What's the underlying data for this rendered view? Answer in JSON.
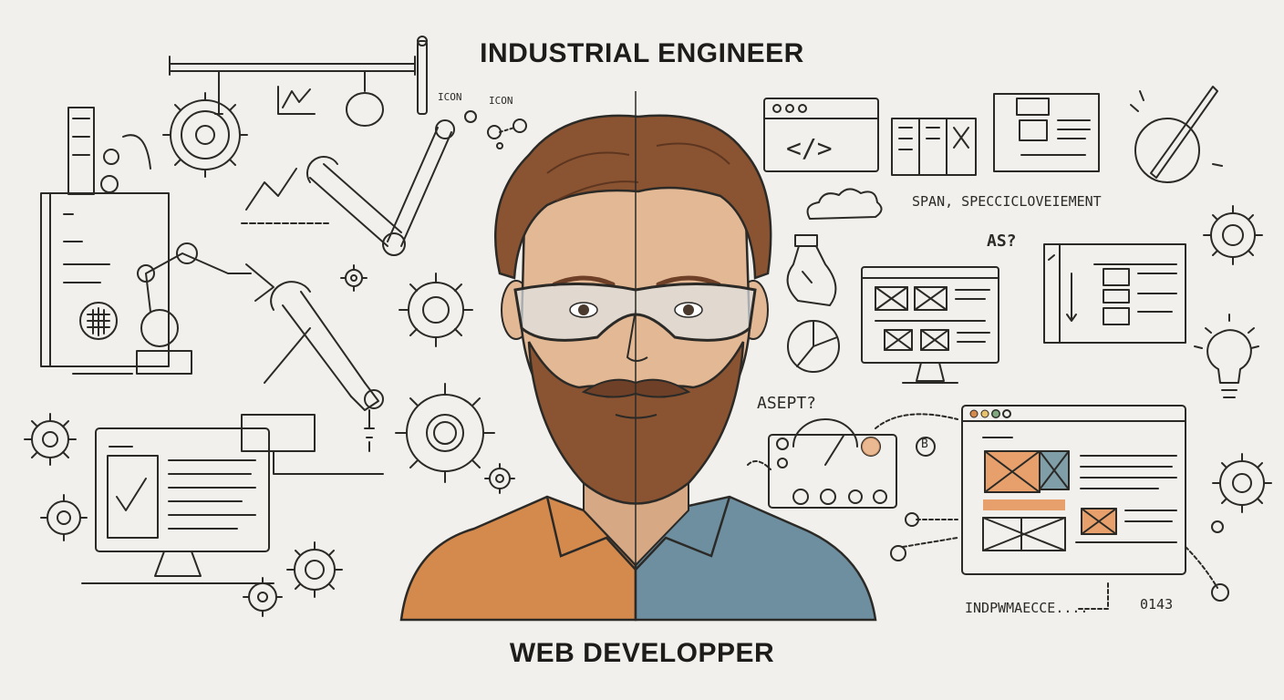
{
  "headings": {
    "top": "INDUSTRIAL ENGINEER",
    "bottom": "WEB DEVELOPPER"
  },
  "notes": {
    "icon_a": "ICON",
    "icon_b": "ICON",
    "code_tag": "</>",
    "span_note": "SPAN, SPECCICLOVEIEMENT",
    "ast_note": "AS?",
    "aspt_note": "ASEPT?",
    "b_node": "B",
    "bottom_note": "INDPWMAECCE....",
    "bottom_note_2": "0143"
  },
  "colors": {
    "paper": "#f1f0ec",
    "ink": "#2b2a27",
    "hair": "#8a5432",
    "skin": "#e3b894",
    "shirt_left": "#d4894d",
    "shirt_right": "#6e8fa0",
    "accent_orange": "#e7a06b",
    "accent_blue": "#7f9ea8"
  }
}
